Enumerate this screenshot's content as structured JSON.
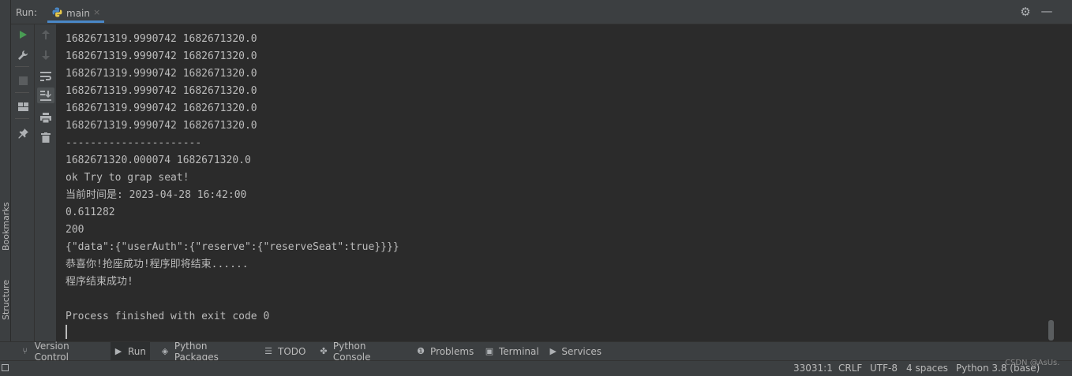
{
  "left_strip": {
    "bookmarks_label": "Bookmarks",
    "structure_label": "Structure"
  },
  "run_header": {
    "run_label": "Run:",
    "tab_label": "main",
    "tab_icon": "python-icon",
    "close_glyph": "×",
    "settings_icon": "gear-icon",
    "minimize_icon": "minimize-icon"
  },
  "toolbar_1": [
    {
      "name": "rerun-icon",
      "glyph": "▶",
      "color": "#499c54"
    },
    {
      "name": "wrench-icon",
      "glyph": "🔧"
    },
    {
      "name": "stop-icon",
      "glyph": "■"
    },
    {
      "name": "layout-icon",
      "glyph": "▦"
    },
    {
      "name": "pin-icon",
      "glyph": "📌"
    }
  ],
  "toolbar_2": [
    {
      "name": "up-arrow-icon",
      "glyph": "↑"
    },
    {
      "name": "down-arrow-icon",
      "glyph": "↓"
    },
    {
      "name": "soft-wrap-icon",
      "glyph": "↩"
    },
    {
      "name": "scroll-to-end-icon",
      "glyph": "⤓"
    },
    {
      "name": "print-icon",
      "glyph": "⎙"
    },
    {
      "name": "trash-icon",
      "glyph": "🗑"
    }
  ],
  "console": {
    "lines": [
      "1682671319.9990742 1682671320.0",
      "1682671319.9990742 1682671320.0",
      "1682671319.9990742 1682671320.0",
      "1682671319.9990742 1682671320.0",
      "1682671319.9990742 1682671320.0",
      "1682671319.9990742 1682671320.0",
      "1682671319.9990742 1682671320.0",
      "----------------------",
      "1682671320.000074 1682671320.0",
      "ok Try to grap seat!",
      "当前时间是: 2023-04-28 16:42:00",
      "0.611282",
      "200",
      "{\"data\":{\"userAuth\":{\"reserve\":{\"reserveSeat\":true}}}}",
      "恭喜你!抢座成功!程序即将结束......",
      "程序结束成功!",
      "",
      "Process finished with exit code 0"
    ]
  },
  "tool_tabs": [
    {
      "label": "Version Control",
      "icon": "version-control-icon",
      "glyph": "⑂"
    },
    {
      "label": "Run",
      "icon": "run-icon",
      "glyph": "▶",
      "active": true
    },
    {
      "label": "Python Packages",
      "icon": "packages-icon",
      "glyph": "◈"
    },
    {
      "label": "TODO",
      "icon": "todo-icon",
      "glyph": "☰"
    },
    {
      "label": "Python Console",
      "icon": "python-console-icon",
      "glyph": "✤"
    },
    {
      "label": "Problems",
      "icon": "problems-icon",
      "glyph": "❶"
    },
    {
      "label": "Terminal",
      "icon": "terminal-icon",
      "glyph": "▣"
    },
    {
      "label": "Services",
      "icon": "services-icon",
      "glyph": "▶"
    }
  ],
  "status_bar": {
    "position": "33031:1",
    "line_separator": "CRLF",
    "encoding": "UTF-8",
    "indent": "4 spaces",
    "interpreter": "Python 3.8 (base)",
    "watermark": "CSDN @AsUs."
  }
}
